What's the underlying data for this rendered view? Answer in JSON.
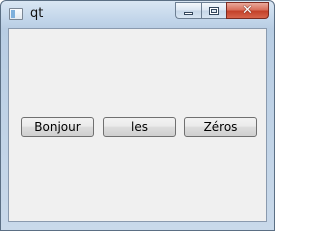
{
  "window": {
    "title": "qt",
    "icons": {
      "app": "window-app-icon",
      "minimize": "minimize-icon",
      "maximize": "maximize-icon",
      "close": "close-icon"
    },
    "close_glyph": "✕"
  },
  "buttons": [
    {
      "label": "Bonjour"
    },
    {
      "label": "les"
    },
    {
      "label": "Zéros"
    }
  ],
  "colors": {
    "frame": "#c3d6ea",
    "client_bg": "#f0f0f0",
    "close_button": "#c4412a"
  }
}
